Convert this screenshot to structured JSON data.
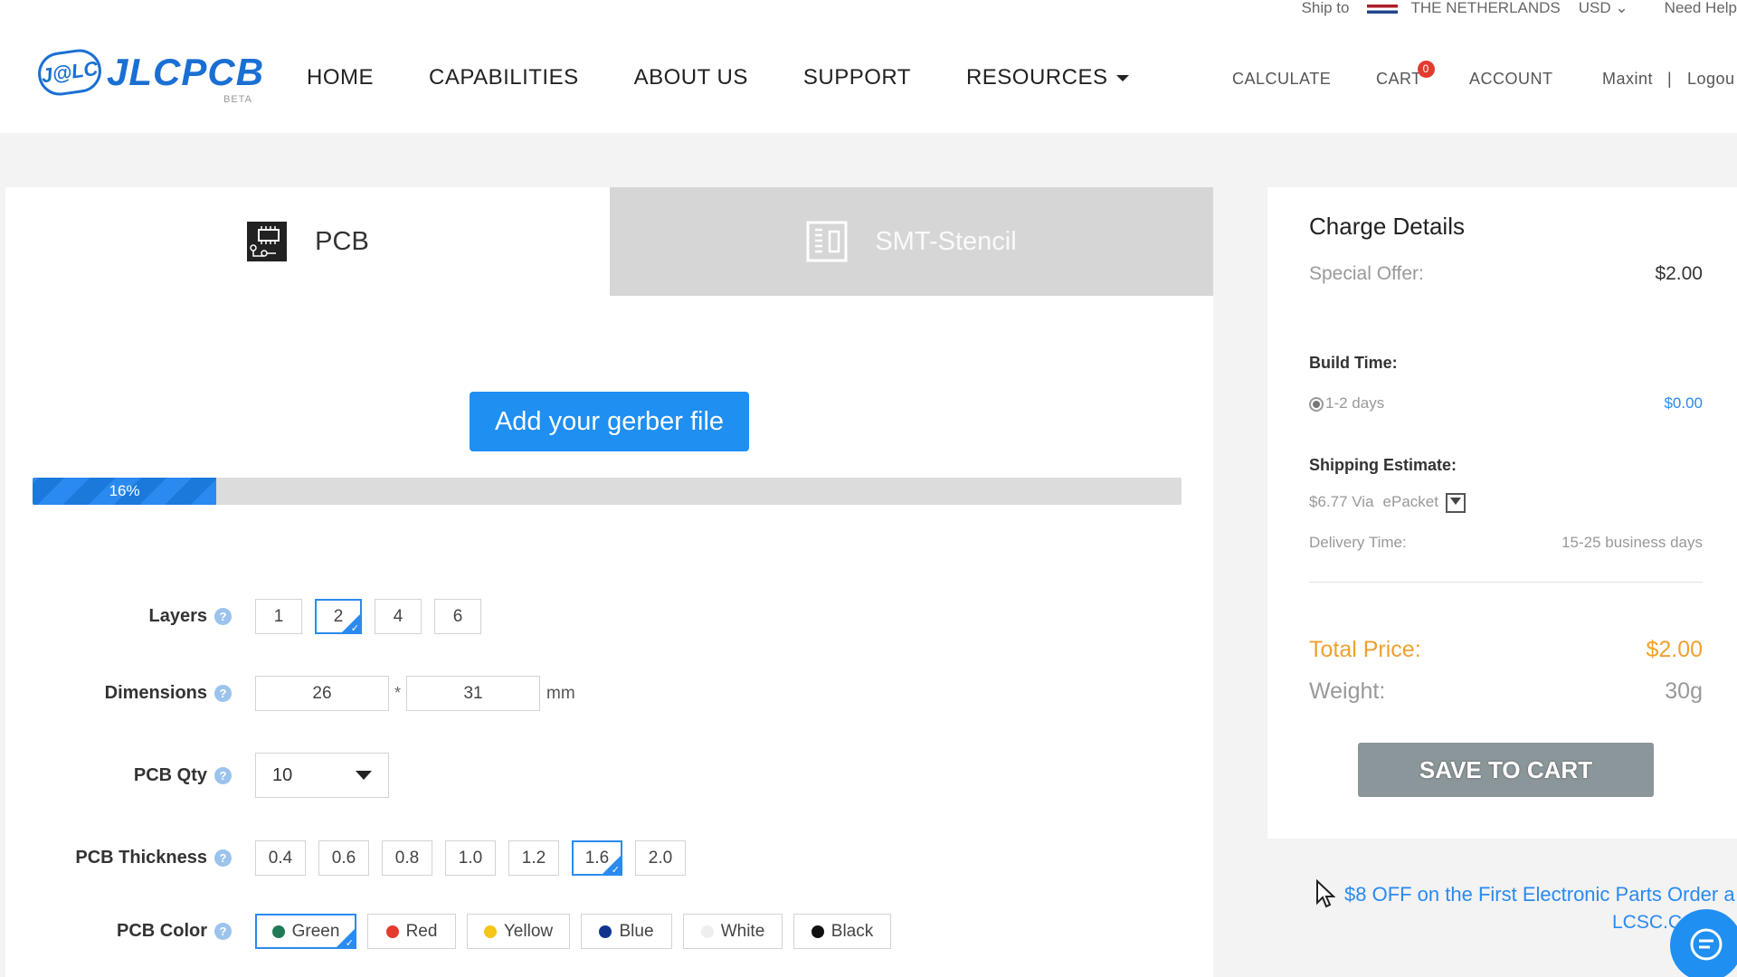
{
  "topbar": {
    "ship_to": "Ship to",
    "country": "THE NETHERLANDS",
    "currency": "USD",
    "help": "Need Help"
  },
  "logo": {
    "badge": "J@LC",
    "name": "JLCPCB",
    "beta": "BETA"
  },
  "nav": {
    "items": [
      "HOME",
      "CAPABILITIES",
      "ABOUT US",
      "SUPPORT",
      "RESOURCES"
    ]
  },
  "right_nav": {
    "calculate": "CALCULATE",
    "cart": "CART",
    "cart_count": "0",
    "account": "ACCOUNT",
    "user": "Maxint",
    "separator": "|",
    "logout": "Logou"
  },
  "tabs": {
    "pcb": "PCB",
    "smt": "SMT-Stencil"
  },
  "upload": {
    "label": "Add your gerber file"
  },
  "progress": {
    "label": "16%",
    "value": 0.16
  },
  "form": {
    "layers": {
      "label": "Layers",
      "options": [
        "1",
        "2",
        "4",
        "6"
      ],
      "selected": "2"
    },
    "dimensions": {
      "label": "Dimensions",
      "width": "26",
      "height": "31",
      "sep": "*",
      "unit": "mm"
    },
    "qty": {
      "label": "PCB Qty",
      "value": "10"
    },
    "thickness": {
      "label": "PCB Thickness",
      "options": [
        "0.4",
        "0.6",
        "0.8",
        "1.0",
        "1.2",
        "1.6",
        "2.0"
      ],
      "selected": "1.6"
    },
    "color": {
      "label": "PCB Color",
      "options": [
        {
          "name": "Green",
          "color": "#1f7a55"
        },
        {
          "name": "Red",
          "color": "#e53a2f"
        },
        {
          "name": "Yellow",
          "color": "#f5c518"
        },
        {
          "name": "Blue",
          "color": "#12348f"
        },
        {
          "name": "White",
          "color": "#eeeeee"
        },
        {
          "name": "Black",
          "color": "#111111"
        }
      ],
      "selected": "Green"
    },
    "help_glyph": "?"
  },
  "charge": {
    "title": "Charge Details",
    "special_offer_label": "Special Offer:",
    "special_offer_value": "$2.00",
    "build_time_label": "Build Time:",
    "build_time_option": "1-2 days",
    "build_time_price": "$0.00",
    "shipping_label": "Shipping Estimate:",
    "shipping_value": "$6.77 Via",
    "shipping_method": "ePacket",
    "delivery_label": "Delivery Time:",
    "delivery_value": "15-25 business days",
    "total_label": "Total Price:",
    "total_value": "$2.00",
    "weight_label": "Weight:",
    "weight_value": "30g",
    "save_label": "SAVE TO CART"
  },
  "promo": {
    "line1": "$8 OFF on the First Electronic Parts Order a",
    "line2": "LCSC.C"
  },
  "colors": {
    "accent": "#1f8ff2",
    "orange": "#f0a030",
    "badge": "#e53a2f"
  }
}
